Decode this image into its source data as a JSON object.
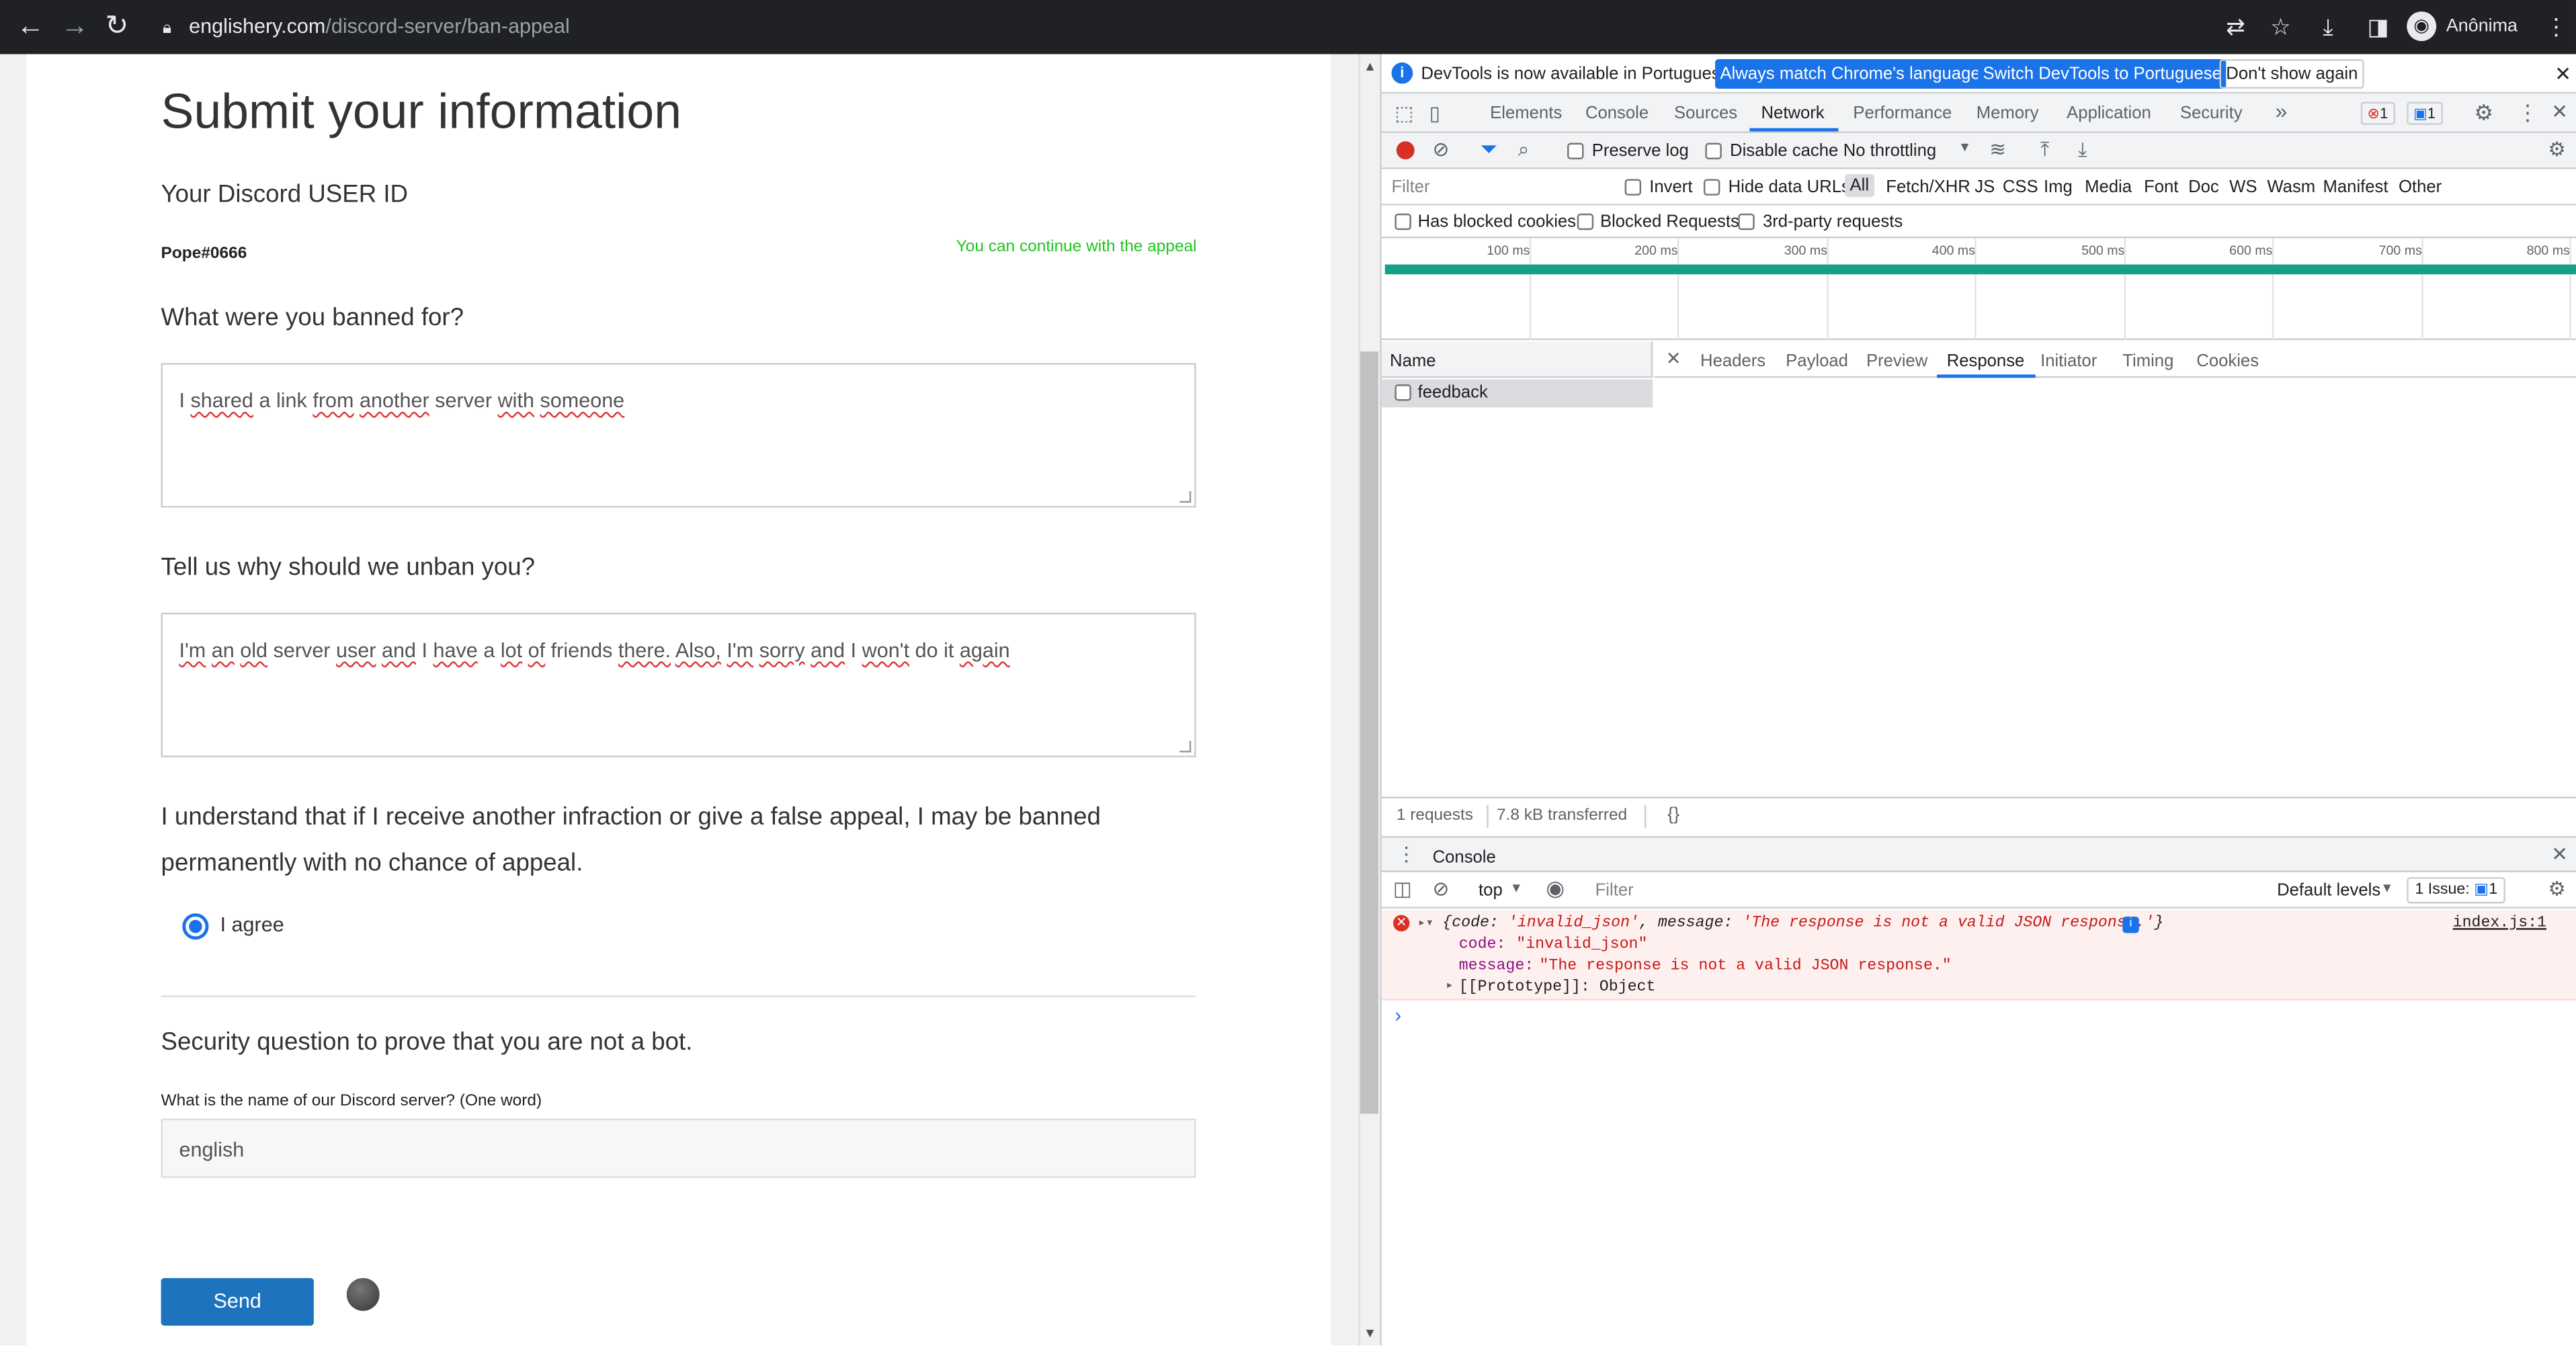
{
  "browser": {
    "url_host": "englishery.com",
    "url_path": "/discord-server/ban-appeal",
    "profile_label": "Anônima"
  },
  "form": {
    "title": "Submit your information",
    "user_id_label": "Your Discord USER ID",
    "user_id_value": "Pope#0666",
    "user_id_status": "You can continue with the appeal",
    "banned_for_label": "What were you banned for?",
    "banned_for_words": [
      "I",
      "shared",
      "a",
      "link",
      "from",
      "another",
      "server",
      "with",
      "someone"
    ],
    "unban_label": "Tell us why should we unban you?",
    "unban_words": [
      "I'm",
      "an",
      "old",
      "server",
      "user",
      "and",
      "I",
      "have",
      "a",
      "lot",
      "of",
      "friends",
      "there.",
      "Also,",
      "I'm",
      "sorry",
      "and",
      "I",
      "won't",
      "do",
      "it",
      "again"
    ],
    "agreement_text": "I understand that if I receive another infraction or give a false appeal, I may be banned permanently with no chance of appeal.",
    "agree_label": "I agree",
    "security_heading": "Security question to prove that you are not a bot.",
    "security_question": "What is the name of our Discord server? (One word)",
    "security_answer": "english",
    "send_label": "Send"
  },
  "devtools": {
    "info_message": "DevTools is now available in Portuguese!",
    "btn_match_language": "Always match Chrome's language",
    "btn_switch_portuguese": "Switch DevTools to Portuguese",
    "btn_dont_show": "Don't show again",
    "tabs": [
      "Elements",
      "Console",
      "Sources",
      "Network",
      "Performance",
      "Memory",
      "Application",
      "Security"
    ],
    "active_tab": "Network",
    "more_tabs": "»",
    "error_count": "1",
    "message_count": "1",
    "preserve_log": "Preserve log",
    "disable_cache": "Disable cache",
    "throttling": "No throttling",
    "filter_placeholder": "Filter",
    "invert": "Invert",
    "hide_data_urls": "Hide data URLs",
    "type_filters": [
      "All",
      "Fetch/XHR",
      "JS",
      "CSS",
      "Img",
      "Media",
      "Font",
      "Doc",
      "WS",
      "Wasm",
      "Manifest",
      "Other"
    ],
    "has_blocked_cookies": "Has blocked cookies",
    "blocked_requests": "Blocked Requests",
    "third_party": "3rd-party requests",
    "timeline_ticks": [
      "100 ms",
      "200 ms",
      "300 ms",
      "400 ms",
      "500 ms",
      "600 ms",
      "700 ms",
      "800 ms"
    ],
    "name_header": "Name",
    "request_name": "feedback",
    "detail_tabs": [
      "Headers",
      "Payload",
      "Preview",
      "Response",
      "Initiator",
      "Timing",
      "Cookies"
    ],
    "active_detail_tab": "Response",
    "requests_count": "1 requests",
    "transferred": "7.8 kB transferred",
    "pretty_print": "{}",
    "console_tab": "Console",
    "context": "top",
    "console_filter": "Filter",
    "default_levels": "Default levels",
    "issues": "1 Issue:",
    "issues_count": "1",
    "error_summary_prefix": "{code: ",
    "error_code_q": "'invalid_json'",
    "error_message_key": ", message: ",
    "error_message_q": "'The response is not a valid JSON response.'",
    "error_close": "}",
    "error_source": "index.js:1",
    "code_key": "code:",
    "code_val": "\"invalid_json\"",
    "message_key": "message:",
    "message_val": "\"The response is not a valid JSON response.\"",
    "prototype": "[[Prototype]]: Object",
    "prompt": "›"
  },
  "colors": {
    "accent": "#1a73e8",
    "send_button": "#1e73be",
    "ok_green": "#22c322",
    "error_red": "#d93025",
    "timeline_green": "#16a085"
  }
}
